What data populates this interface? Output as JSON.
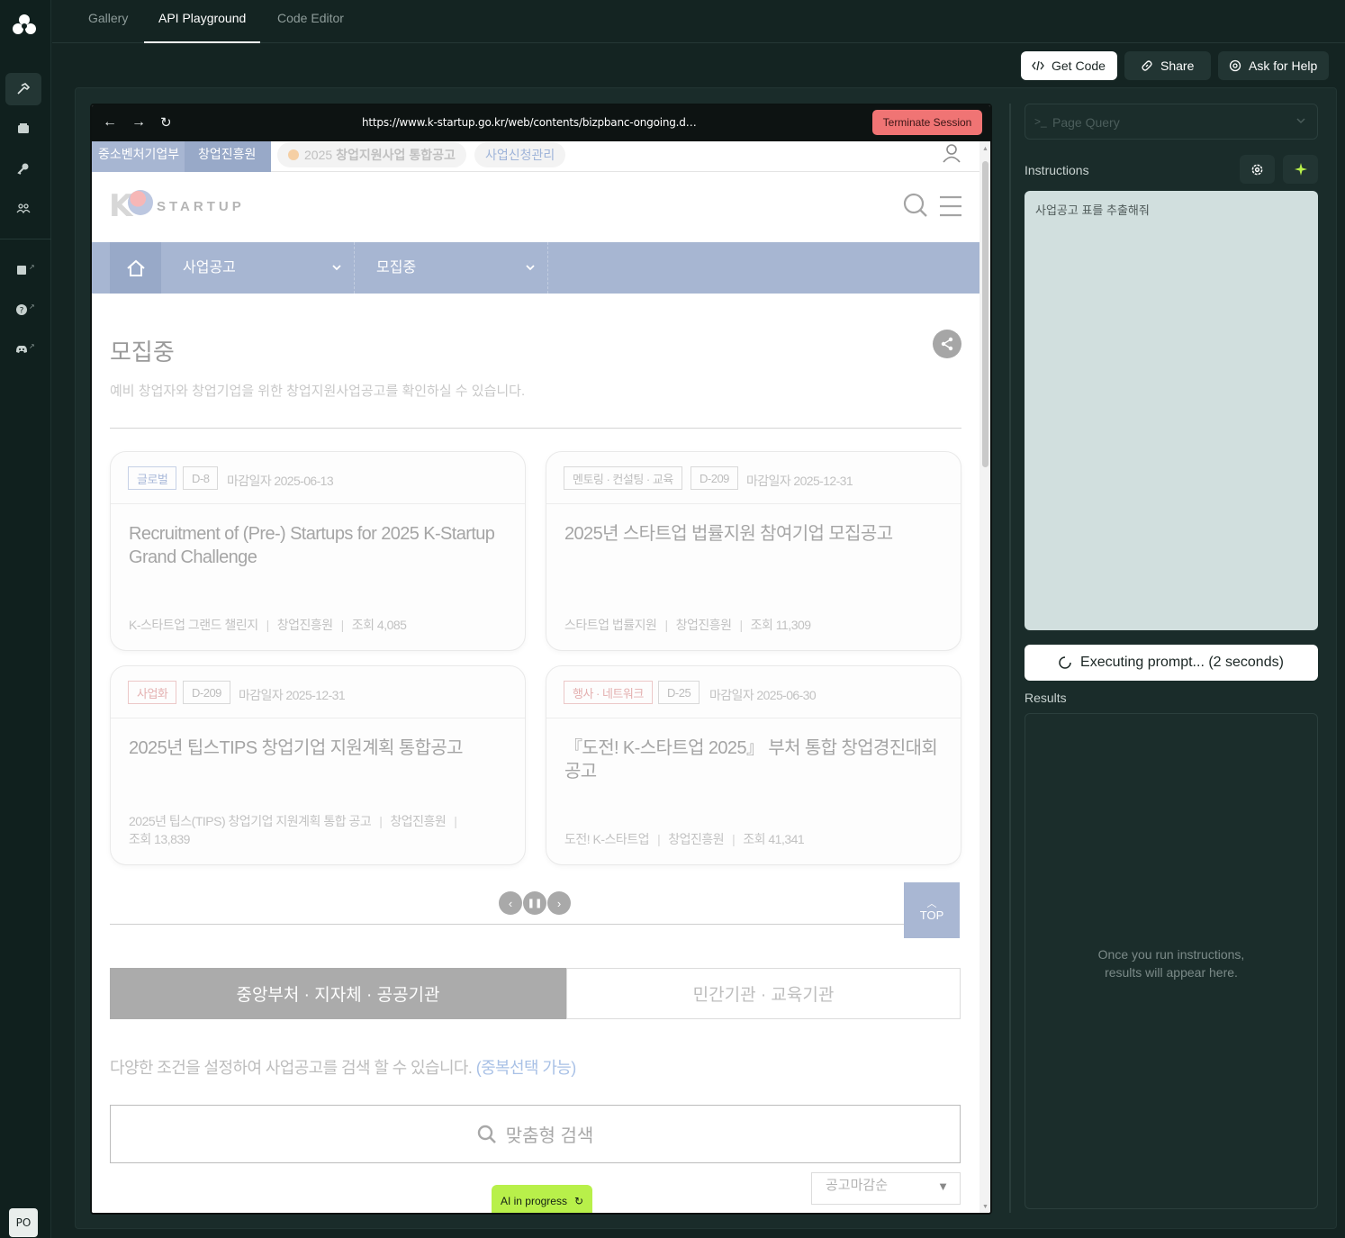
{
  "user": {
    "initials": "PO"
  },
  "tabs": [
    {
      "label": "Gallery",
      "active": false
    },
    {
      "label": "API Playground",
      "active": true
    },
    {
      "label": "Code Editor",
      "active": false
    }
  ],
  "header": {
    "get_code": "Get Code",
    "share": "Share",
    "help": "Ask for Help"
  },
  "browser": {
    "url": "https://www.k-startup.go.kr/web/contents/bizpbanc-ongoing.d…",
    "terminate": "Terminate Session"
  },
  "site": {
    "util": {
      "org1": "중소벤처기업부",
      "org2": "창업진흥원",
      "notice_year": "2025",
      "notice": "창업지원사업 통합공고",
      "manage": "사업신청관리"
    },
    "brand_word": "STARTUP",
    "brand_letter": "K",
    "gnb": {
      "menu1": "사업공고",
      "menu2": "모집중"
    },
    "page_title": "모집중",
    "page_desc": "예비 창업자와 창업기업을 위한 창업지원사업공고를 확인하실 수 있습니다.",
    "cards": [
      {
        "tag": "글로벌",
        "dday": "D-8",
        "deadline": "마감일자 2025-06-13",
        "title": "Recruitment of (Pre-) Startups for 2025 K-Startup Grand Challenge",
        "program": "K-스타트업 그랜드 챌린지",
        "org": "창업진흥원",
        "views": "조회 4,085"
      },
      {
        "tag": "멘토링 · 컨설팅 · 교육",
        "dday": "D-209",
        "deadline": "마감일자 2025-12-31",
        "title": "2025년 스타트업 법률지원 참여기업 모집공고",
        "program": "스타트업 법률지원",
        "org": "창업진흥원",
        "views": "조회 11,309"
      },
      {
        "tag": "사업화",
        "dday": "D-209",
        "deadline": "마감일자 2025-12-31",
        "title": "2025년 팁스TIPS 창업기업 지원계획 통합공고",
        "program": "2025년 팁스(TIPS) 창업기업 지원계획 통합 공고",
        "org": "창업진흥원",
        "views": "조회 13,839"
      },
      {
        "tag": "행사 · 네트워크",
        "dday": "D-25",
        "deadline": "마감일자 2025-06-30",
        "title": "『도전! K-스타트업 2025』 부처 통합 창업경진대회 공고",
        "program": "도전! K-스타트업",
        "org": "창업진흥원",
        "views": "조회 41,341"
      }
    ],
    "top_label": "TOP",
    "seg_on": "중앙부처 · 지자체 · 공공기관",
    "seg_off": "민간기관 · 교육기관",
    "cond_text": "다양한 조건을 설정하여 사업공고를 검색 할 수 있습니다.",
    "cond_hl": "(중복선택 가능)",
    "custom_search": "맞춤형 검색",
    "sort": "공고마감순"
  },
  "ai_badge": "AI in progress",
  "right": {
    "page_query_placeholder": "Page Query",
    "instructions_label": "Instructions",
    "instructions_text": "사업공고 표를 추출해줘",
    "executing": "Executing prompt... (2 seconds)",
    "results_label": "Results",
    "results_empty_1": "Once you run instructions,",
    "results_empty_2": "results will appear here."
  }
}
